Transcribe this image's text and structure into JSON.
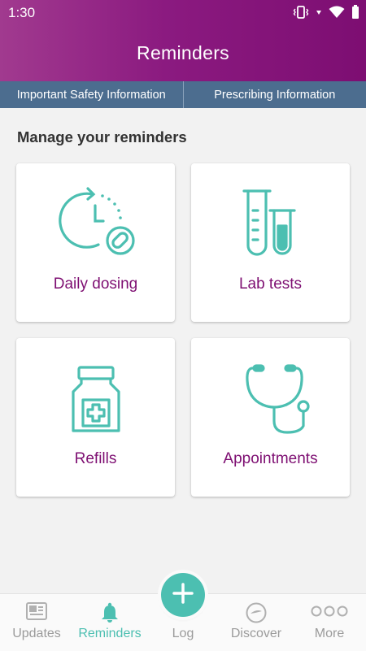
{
  "status_bar": {
    "time": "1:30"
  },
  "header": {
    "title": "Reminders"
  },
  "info_tabs": [
    {
      "label": "Important Safety Information"
    },
    {
      "label": "Prescribing Information"
    }
  ],
  "section_title": "Manage your reminders",
  "cards": [
    {
      "label": "Daily dosing",
      "icon": "clock-pill-icon"
    },
    {
      "label": "Lab tests",
      "icon": "test-tubes-icon"
    },
    {
      "label": "Refills",
      "icon": "medicine-bottle-icon"
    },
    {
      "label": "Appointments",
      "icon": "stethoscope-icon"
    }
  ],
  "bottom_nav": [
    {
      "label": "Updates",
      "icon": "newspaper-icon",
      "active": false
    },
    {
      "label": "Reminders",
      "icon": "bell-icon",
      "active": true
    },
    {
      "label": "Log",
      "icon": "plus-icon",
      "active": false
    },
    {
      "label": "Discover",
      "icon": "compass-icon",
      "active": false
    },
    {
      "label": "More",
      "icon": "more-dots-icon",
      "active": false
    }
  ],
  "colors": {
    "brand_purple": "#7e0f72",
    "teal": "#4cbfb1",
    "info_bar": "#4c6d8f"
  }
}
